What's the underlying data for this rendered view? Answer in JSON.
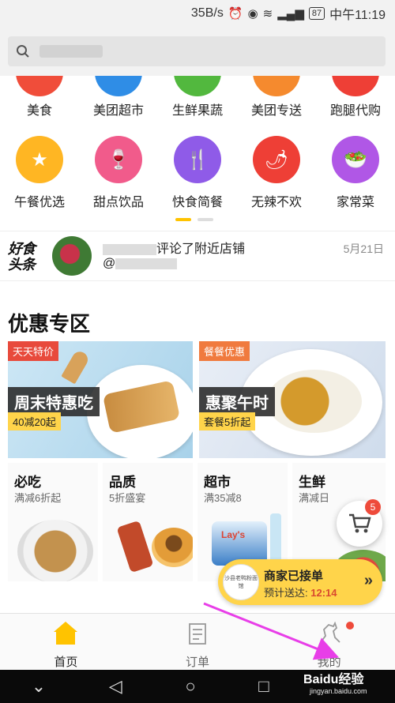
{
  "status_bar": {
    "speed": "35B/s",
    "battery": "87",
    "time": "中午11:19",
    "network": "4G"
  },
  "search": {
    "placeholder": ""
  },
  "categories_row1": [
    {
      "label": "美食",
      "color": "#f04d3a",
      "icon": "food-icon"
    },
    {
      "label": "美团超市",
      "color": "#2f8de6",
      "icon": "basket-icon"
    },
    {
      "label": "生鲜果蔬",
      "color": "#52b83e",
      "icon": "apple-icon"
    },
    {
      "label": "美团专送",
      "color": "#f58a2e",
      "icon": "delivery-icon"
    },
    {
      "label": "跑腿代购",
      "color": "#ee3f36",
      "icon": "runner-icon"
    }
  ],
  "categories_row2": [
    {
      "label": "午餐优选",
      "color": "#ffb623",
      "glyph": "★"
    },
    {
      "label": "甜点饮品",
      "color": "#f15b8b",
      "glyph": "🍷"
    },
    {
      "label": "快食简餐",
      "color": "#8f5be8",
      "glyph": "🍴"
    },
    {
      "label": "无辣不欢",
      "color": "#ee3f36",
      "glyph": "🌶"
    },
    {
      "label": "家常菜",
      "color": "#b057e6",
      "glyph": "🥗"
    }
  ],
  "headline": {
    "logo": "好食头条",
    "text_suffix": "评论了附近店铺",
    "mention": "@",
    "date": "5月21日"
  },
  "section": {
    "title": "优惠专区"
  },
  "promos": [
    {
      "tag": "天天特价",
      "title": "周末特惠吃",
      "sub": "40减20起"
    },
    {
      "tag": "餐餐优惠",
      "title": "惠聚午时",
      "sub": "套餐5折起"
    }
  ],
  "small_cards": [
    {
      "title": "必吃",
      "sub": "满减6折起"
    },
    {
      "title": "品质",
      "sub": "5折盛宴"
    },
    {
      "title": "超市",
      "sub": "满35减8"
    },
    {
      "title": "生鲜",
      "sub": "满减日"
    }
  ],
  "cart": {
    "badge": "5"
  },
  "order_banner": {
    "title": "商家已接单",
    "eta_label": "预计送达:",
    "eta_time": "12:14",
    "thumb_text": "沙县老鸭粉面馆"
  },
  "tabs": [
    {
      "label": "首页"
    },
    {
      "label": "订单"
    },
    {
      "label": "我的"
    }
  ],
  "watermark": {
    "brand": "Baidu经验",
    "url": "jingyan.baidu.com"
  }
}
